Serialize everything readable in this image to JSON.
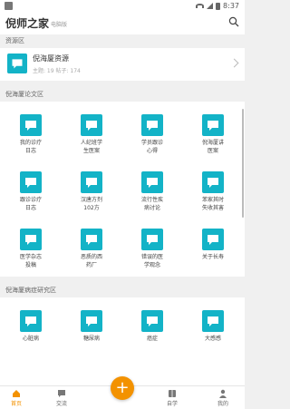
{
  "status_bar": {
    "time": "8:37"
  },
  "app_bar": {
    "title": "倪师之家",
    "subtitle": "电脑版"
  },
  "sections": {
    "resource": "资源区",
    "essays": "倪海厦论文区",
    "disease": "倪海厦病症研究区"
  },
  "resource_card": {
    "name": "倪海厦资源",
    "stats": "主题: 19  帖子: 174"
  },
  "essay_grid": [
    {
      "label": "我的诊疗\n日志"
    },
    {
      "label": "人纪班学\n生医案"
    },
    {
      "label": "学员跟诊\n心得"
    },
    {
      "label": "倪海厦讲\n医案"
    },
    {
      "label": "跟诊诊疗\n日志"
    },
    {
      "label": "汉唐方剂\n102方"
    },
    {
      "label": "流行性疾\n病讨论"
    },
    {
      "label": "苯家其时\n失收其害"
    },
    {
      "label": "医学杂志\n投稿"
    },
    {
      "label": "恶质的西\n药厂"
    },
    {
      "label": "错误的医\n学观念"
    },
    {
      "label": "关于长寿"
    }
  ],
  "disease_grid": [
    {
      "label": "心脏病"
    },
    {
      "label": "糖尿病"
    },
    {
      "label": "癌症"
    },
    {
      "label": "大感感"
    }
  ],
  "tabs": [
    {
      "label": "首页"
    },
    {
      "label": "交流"
    },
    {
      "label": "自学"
    },
    {
      "label": "我的"
    }
  ],
  "fab": {
    "symbol": "+"
  },
  "colors": {
    "accent": "#f39200",
    "icon_teal": "#13b3c7"
  }
}
